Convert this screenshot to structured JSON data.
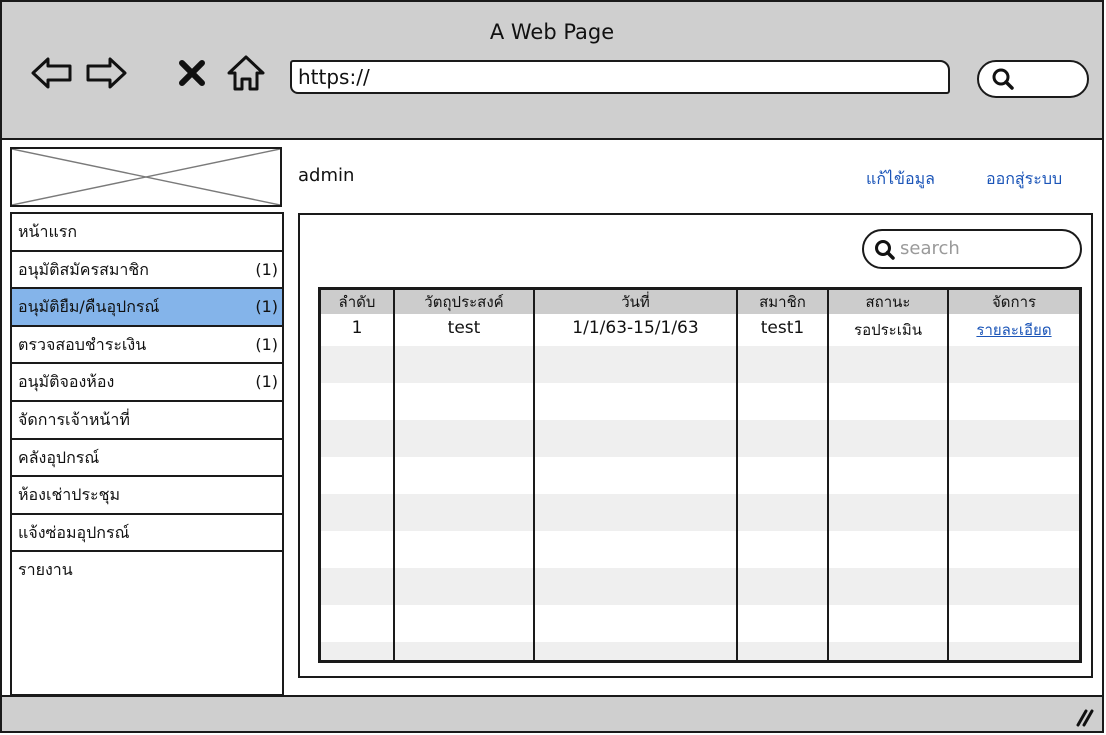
{
  "browser": {
    "title": "A Web Page",
    "url": "https://",
    "nav_icons": [
      "back-arrow-icon",
      "forward-arrow-icon",
      "close-icon",
      "home-icon"
    ],
    "search_icon": "search-icon"
  },
  "header": {
    "username": "admin",
    "edit_profile": "แก้ไข้อมูล",
    "logout": "ออกสู่ระบบ"
  },
  "sidebar": {
    "items": [
      {
        "label": "หน้าแรก",
        "count": ""
      },
      {
        "label": "อนุมัติสมัครสมาชิก",
        "count": "(1)"
      },
      {
        "label": "อนุมัติยืม/คืนอุปกรณ์",
        "count": "(1)"
      },
      {
        "label": "ตรวจสอบชำระเงิน",
        "count": "(1)"
      },
      {
        "label": "อนุมัติจองห้อง",
        "count": "(1)"
      },
      {
        "label": "จัดการเจ้าหน้าที่",
        "count": ""
      },
      {
        "label": "คลังอุปกรณ์",
        "count": ""
      },
      {
        "label": "ห้องเช่าประชุม",
        "count": ""
      },
      {
        "label": "แจ้งซ่อมอุปกรณ์",
        "count": ""
      },
      {
        "label": "รายงาน",
        "count": ""
      }
    ],
    "active_index": 2
  },
  "main": {
    "search_placeholder": "search",
    "table": {
      "columns": [
        "ลำดับ",
        "วัตถุประสงค์",
        "วันที่",
        "สมาชิก",
        "สถานะ",
        "จัดการ"
      ],
      "rows": [
        [
          "1",
          "test",
          "1/1/63-15/1/63",
          "test1",
          "รอประเมิน",
          "รายละเอียด"
        ]
      ]
    }
  },
  "colors": {
    "chrome_bg": "#cfcfcf",
    "active_item": "#84b4ea",
    "link": "#1b55b8",
    "header_bg": "#cccccc",
    "stripe": "#efefef"
  }
}
